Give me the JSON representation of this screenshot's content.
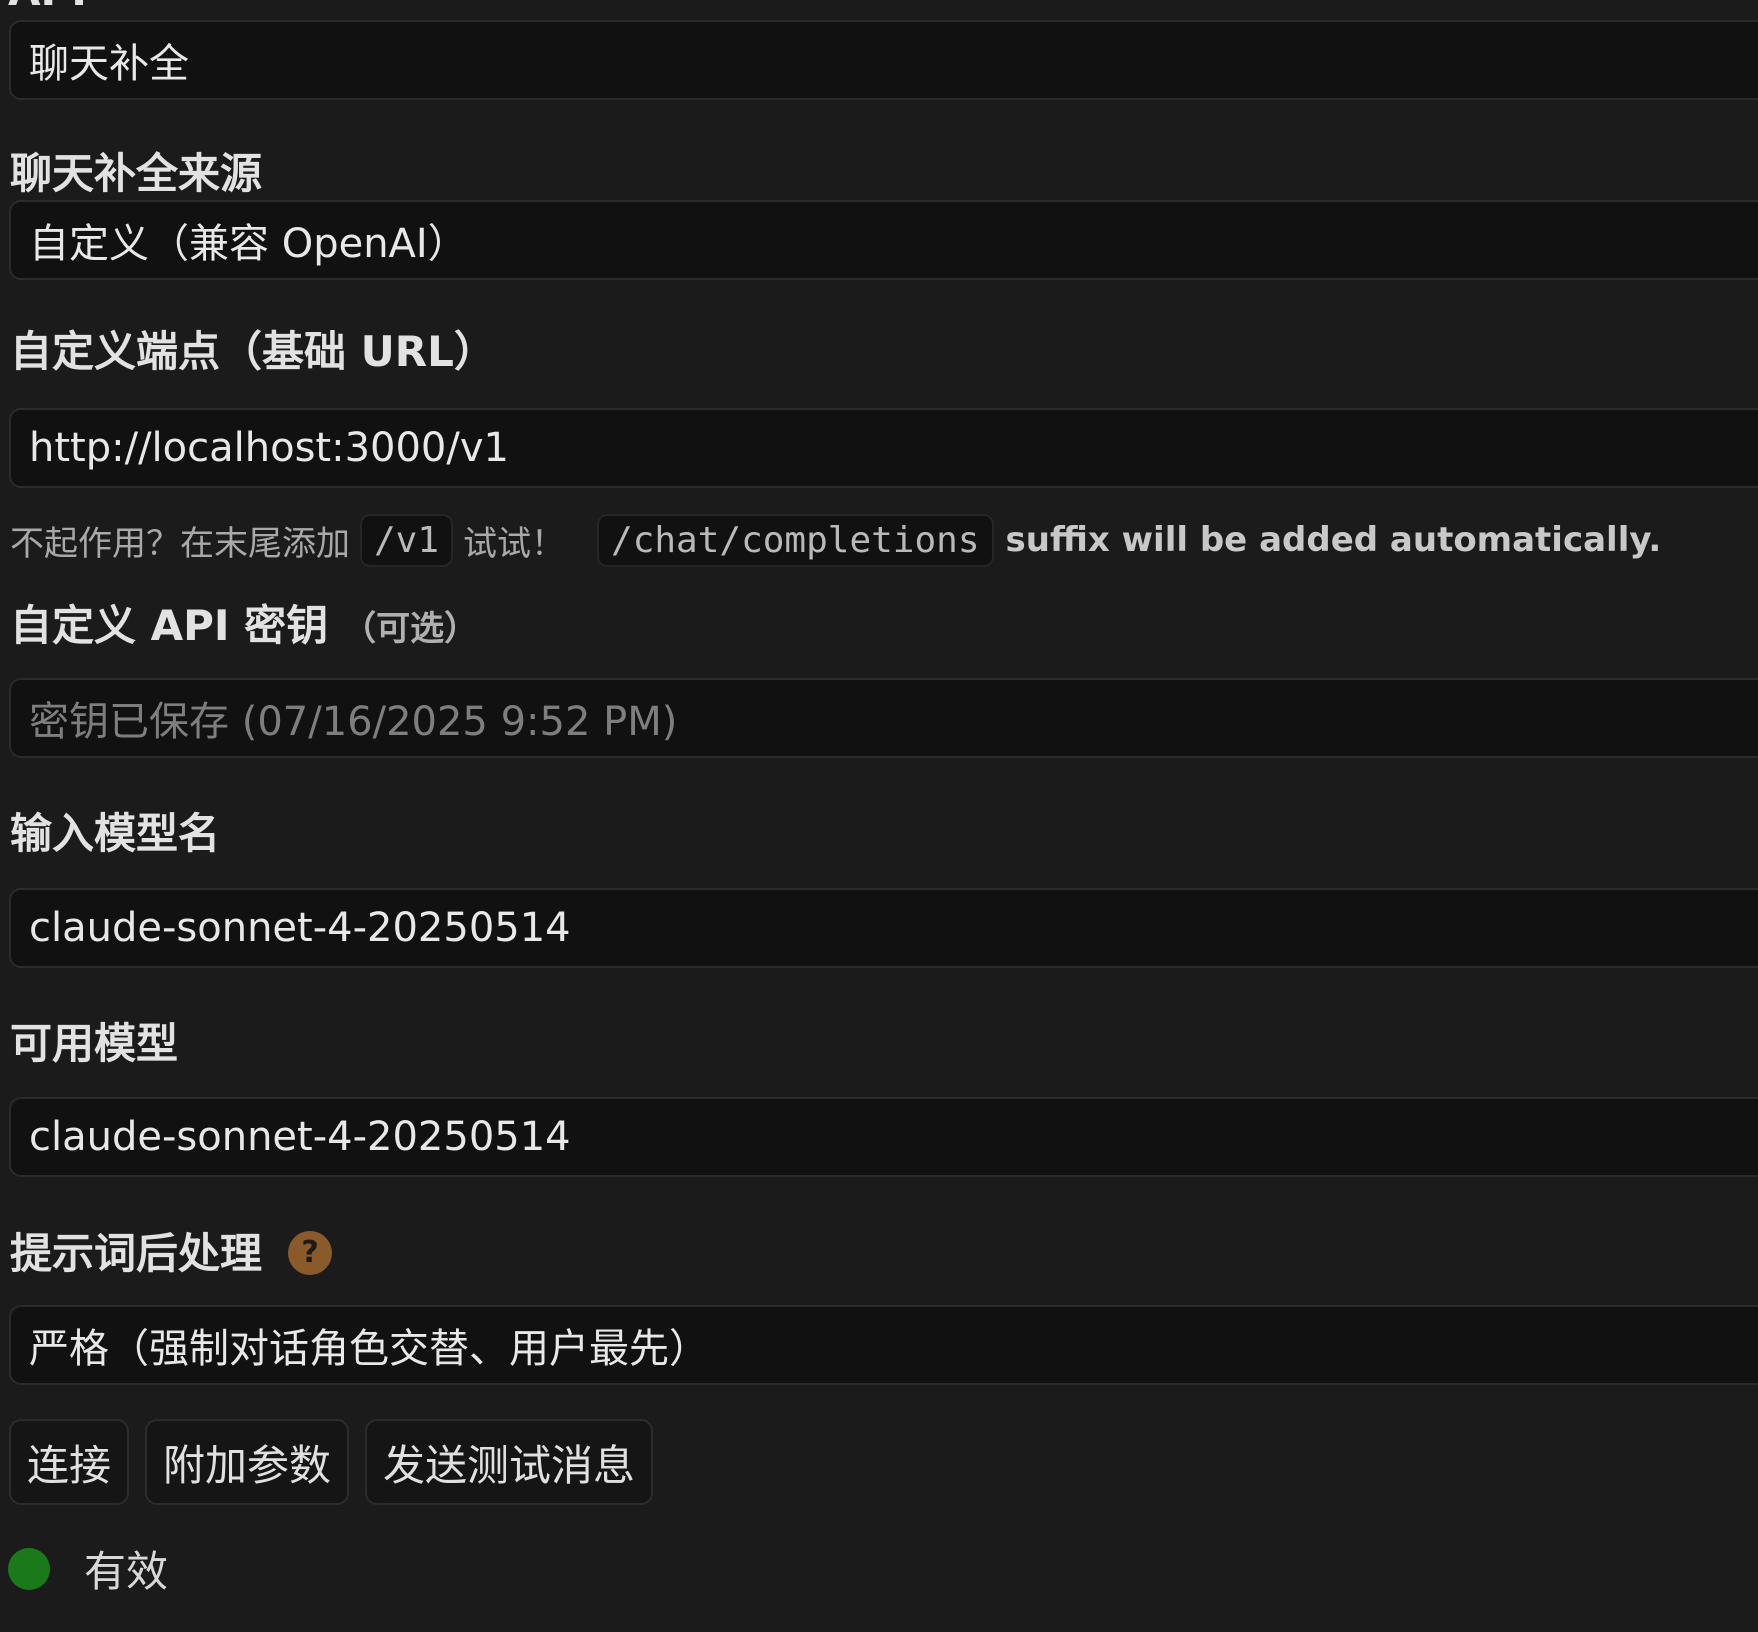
{
  "api": {
    "label": "API",
    "value": "聊天补全"
  },
  "source": {
    "label": "聊天补全来源",
    "value": "自定义（兼容 OpenAI）"
  },
  "endpoint": {
    "label": "自定义端点（基础 URL）",
    "value": "http://localhost:3000/v1",
    "hint_text_1": "不起作用？在末尾添加",
    "hint_code_1": "/v1",
    "hint_text_2": "试试！",
    "hint_code_2": "/chat/completions",
    "hint_text_3": "suffix will be added automatically."
  },
  "api_key": {
    "label": "自定义 API 密钥",
    "sub_label": "（可选）",
    "placeholder": "密钥已保存 (07/16/2025 9:52 PM)"
  },
  "model_input": {
    "label": "输入模型名",
    "value": "claude-sonnet-4-20250514"
  },
  "available_models": {
    "label": "可用模型",
    "value": "claude-sonnet-4-20250514"
  },
  "postprocess": {
    "label": "提示词后处理",
    "help_icon": "?",
    "value": "严格（强制对话角色交替、用户最先）"
  },
  "buttons": {
    "connect": "连接",
    "extra_params": "附加参数",
    "send_test": "发送测试消息"
  },
  "status": {
    "text": "有效",
    "color": "#1a7a1a"
  }
}
